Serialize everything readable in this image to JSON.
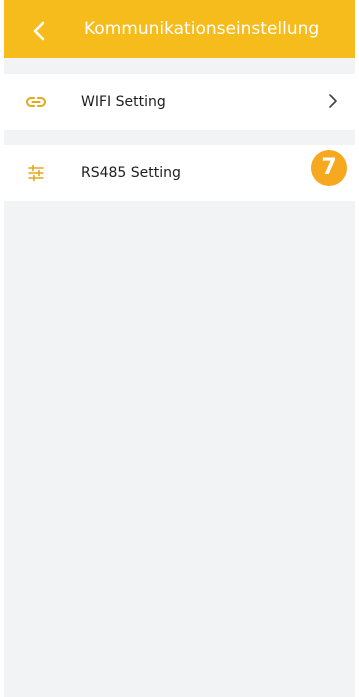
{
  "header": {
    "title": "Kommunikationseinstellung"
  },
  "settings": {
    "items": [
      {
        "label": "WIFI Setting",
        "icon": "link-icon"
      },
      {
        "label": "RS485 Setting",
        "icon": "sliders-icon"
      }
    ]
  },
  "badge": {
    "value": "7"
  },
  "colors": {
    "accent": "#f6bc1c",
    "badge": "#f6a81e",
    "background": "#f2f3f5"
  }
}
